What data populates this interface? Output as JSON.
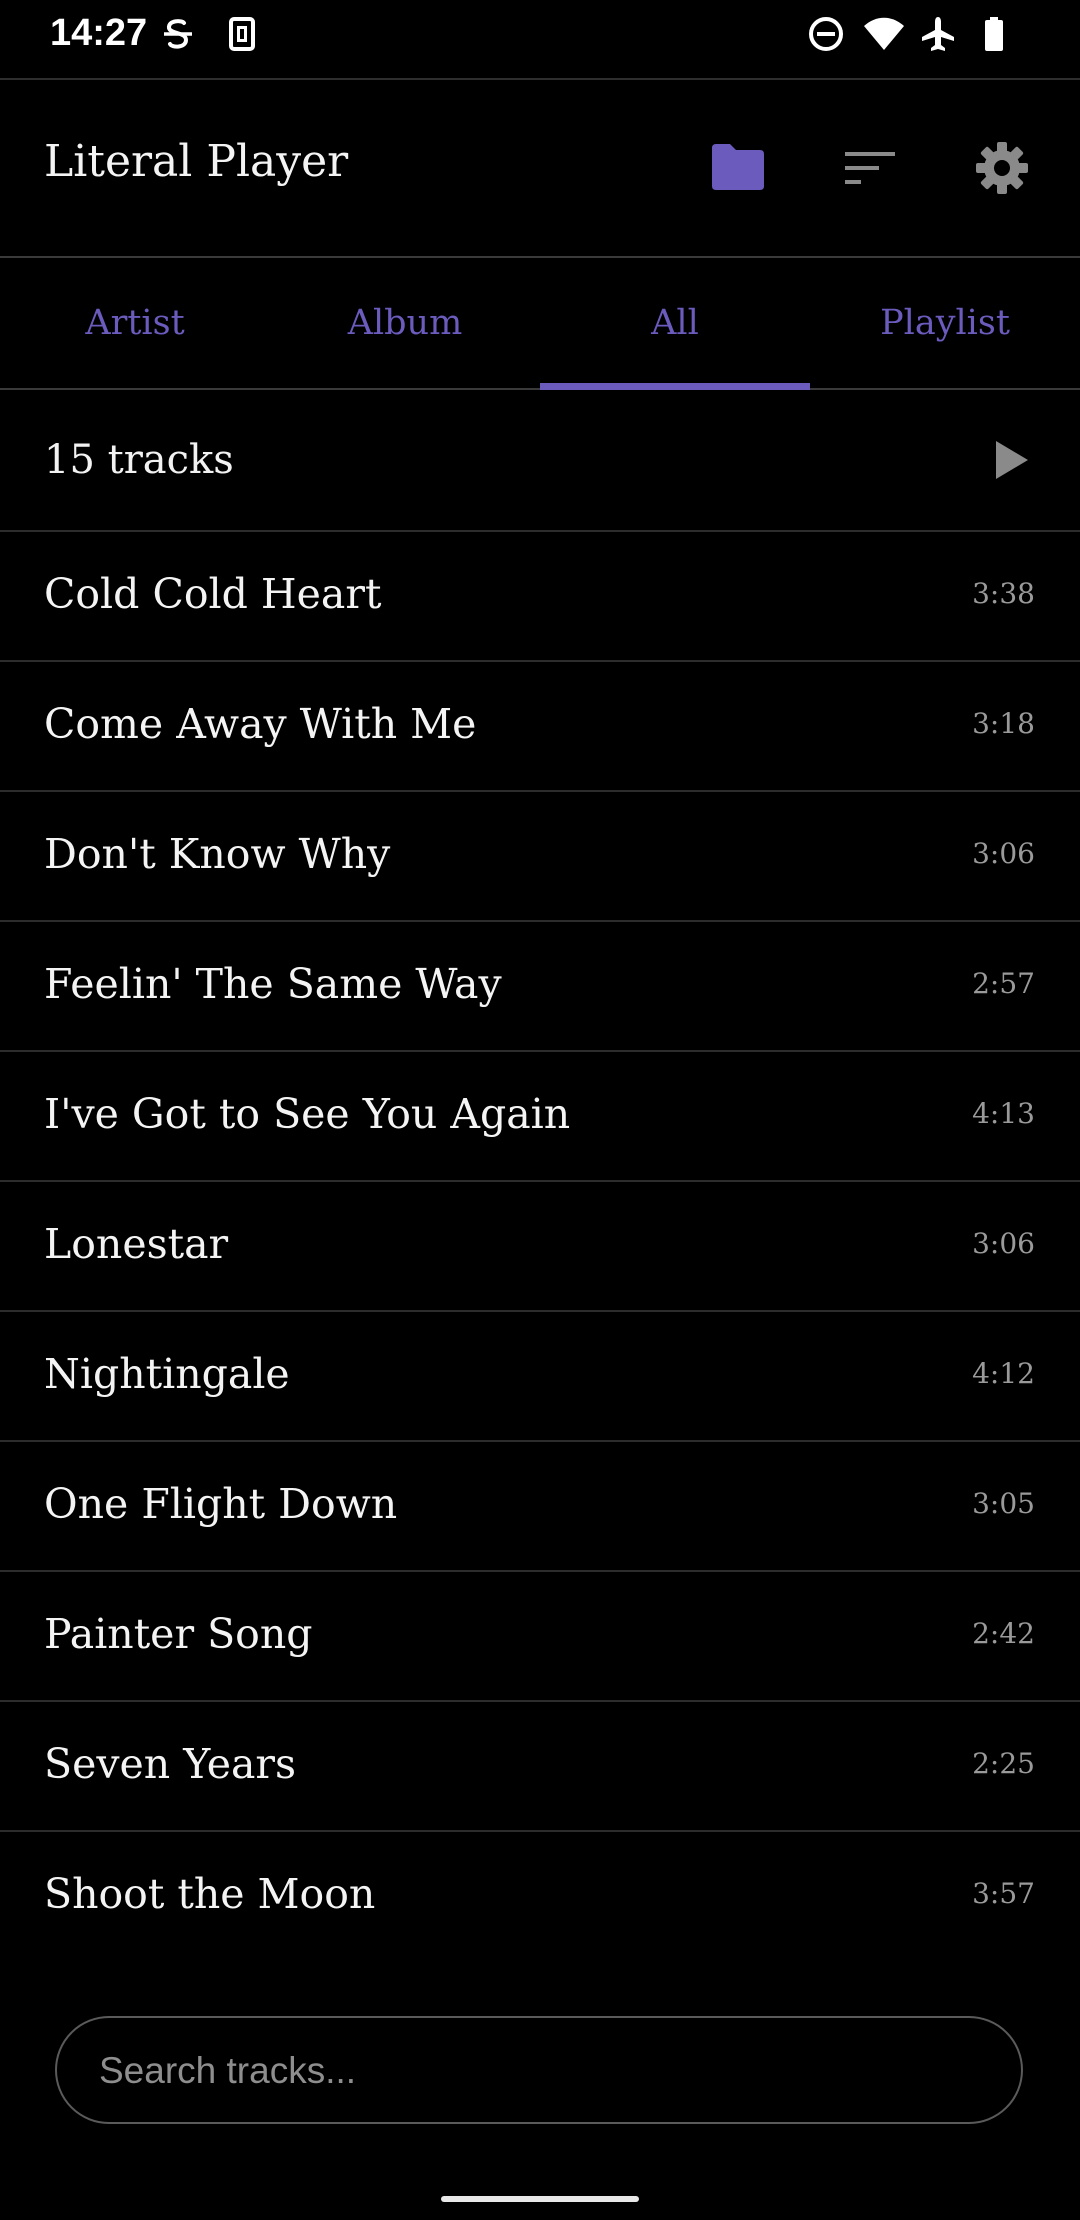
{
  "status_bar": {
    "time": "14:27",
    "icons": [
      "sync-s-icon",
      "sim-card-icon",
      "do-not-disturb-icon",
      "wifi-icon",
      "airplane-icon",
      "battery-icon"
    ]
  },
  "app_bar": {
    "title": "Literal Player",
    "icons": [
      "folder-icon",
      "sort-icon",
      "settings-icon"
    ],
    "accent_color": "#6a5bbd"
  },
  "tabs": [
    {
      "label": "Artist",
      "active": false
    },
    {
      "label": "Album",
      "active": false
    },
    {
      "label": "All",
      "active": true
    },
    {
      "label": "Playlist",
      "active": false
    }
  ],
  "summary": {
    "count_label": "15 tracks",
    "play_icon": "play-icon"
  },
  "tracks": [
    {
      "title": "Cold Cold Heart",
      "duration": "3:38"
    },
    {
      "title": "Come Away With Me",
      "duration": "3:18"
    },
    {
      "title": "Don't Know Why",
      "duration": "3:06"
    },
    {
      "title": "Feelin' The Same Way",
      "duration": "2:57"
    },
    {
      "title": "I've Got to See You Again",
      "duration": "4:13"
    },
    {
      "title": "Lonestar",
      "duration": "3:06"
    },
    {
      "title": "Nightingale",
      "duration": "4:12"
    },
    {
      "title": "One Flight Down",
      "duration": "3:05"
    },
    {
      "title": "Painter Song",
      "duration": "2:42"
    },
    {
      "title": "Seven Years",
      "duration": "2:25"
    },
    {
      "title": "Shoot the Moon",
      "duration": "3:57"
    }
  ],
  "search": {
    "placeholder": "Search tracks...",
    "value": ""
  }
}
